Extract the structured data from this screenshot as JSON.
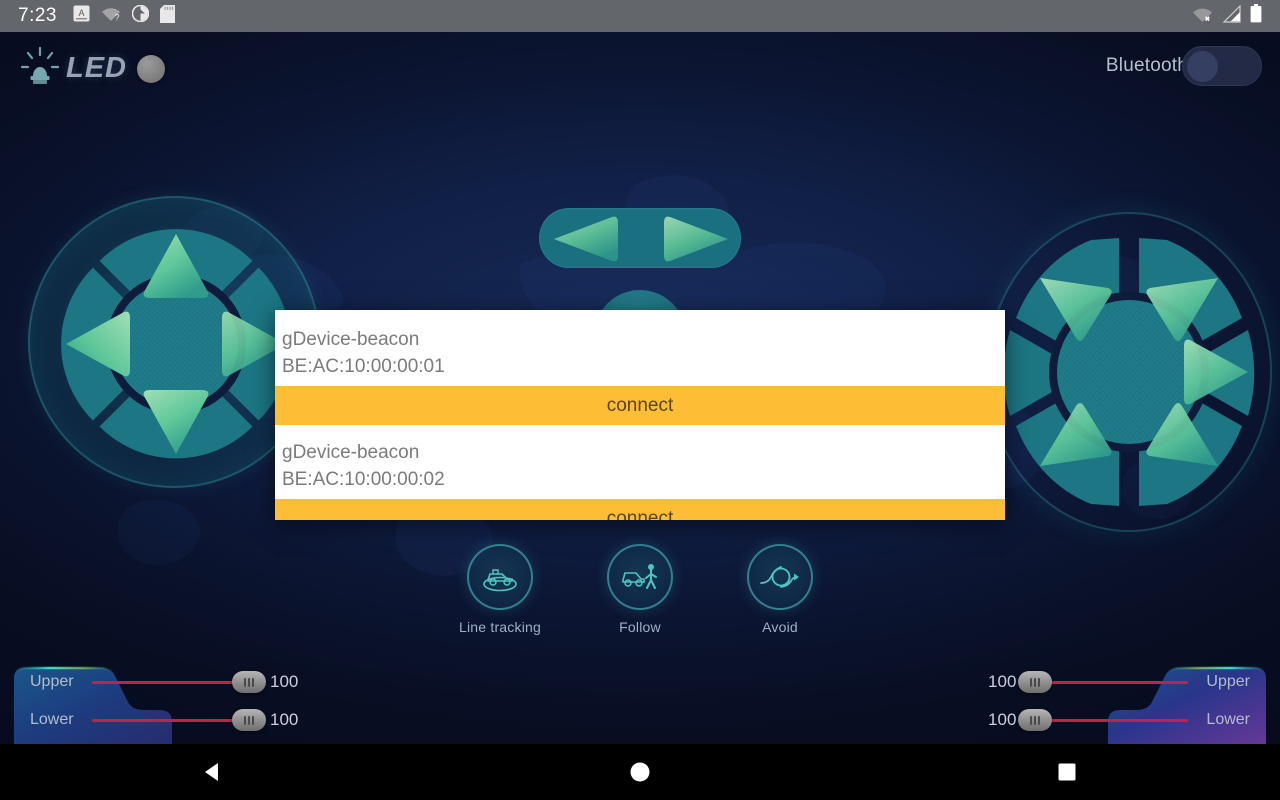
{
  "statusbar": {
    "time": "7:23",
    "left_icons": [
      "keyboard-layout-icon",
      "wifi-off-icon",
      "do-not-disturb-icon",
      "sd-card-icon"
    ],
    "right_icons": [
      "wifi-off-icon",
      "cellular-signal-icon",
      "battery-icon"
    ]
  },
  "header": {
    "led_label": "LED",
    "led_icon": "beacon-light-icon",
    "led_toggle_state": "off",
    "bluetooth_label": "Bluetooth",
    "bluetooth_toggle_state": "off"
  },
  "dialog": {
    "devices": [
      {
        "name": "gDevice-beacon",
        "mac": "BE:AC:10:00:00:01",
        "connect_label": "connect"
      },
      {
        "name": "gDevice-beacon",
        "mac": "BE:AC:10:00:00:02",
        "connect_label": "connect"
      }
    ]
  },
  "modes": [
    {
      "label": "Line tracking",
      "icon": "car-on-line-icon"
    },
    {
      "label": "Follow",
      "icon": "car-following-person-icon"
    },
    {
      "label": "Avoid",
      "icon": "obstacle-avoid-arrow-icon"
    }
  ],
  "sliders": {
    "left": [
      {
        "label": "Upper",
        "value": "100"
      },
      {
        "label": "Lower",
        "value": "100"
      }
    ],
    "right": [
      {
        "label": "Upper",
        "value": "100"
      },
      {
        "label": "Lower",
        "value": "100"
      }
    ]
  },
  "controls": {
    "dpad_directions": [
      "up",
      "left",
      "right",
      "down"
    ],
    "hexwheel_directions": [
      "up-left",
      "up-right",
      "right",
      "down-right",
      "down-left",
      "left"
    ],
    "pill_directions": [
      "left",
      "right"
    ],
    "center_knob": "center-knob"
  },
  "navbar": {
    "back": "back-button",
    "home": "home-button",
    "recents": "recents-button"
  },
  "colors": {
    "accent_orange": "#fdbe35",
    "teal_pad": "#1c7684",
    "arrow_green": "#5ec79a",
    "slider_track": "#c2224a",
    "background_navy": "#0d1838"
  }
}
